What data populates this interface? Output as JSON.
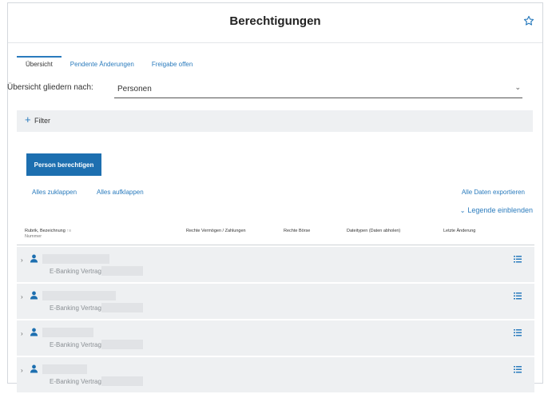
{
  "header": {
    "title": "Berechtigungen",
    "star_icon": "star-icon"
  },
  "tabs": [
    {
      "label": "Übersicht",
      "active": true
    },
    {
      "label": "Pendente Änderungen",
      "active": false
    },
    {
      "label": "Freigabe offen",
      "active": false
    }
  ],
  "grouping": {
    "label": "Übersicht gliedern nach:",
    "value": "Personen"
  },
  "filter": {
    "label": "Filter"
  },
  "actions": {
    "primary_label": "Person berechtigen",
    "collapse_all": "Alles zuklappen",
    "expand_all": "Alles aufklappen",
    "export_all": "Alle Daten exportieren",
    "legend_toggle": "Legende einblenden"
  },
  "table": {
    "columns": {
      "rubrik": "Rubrik, Bezeichnung",
      "rubrik_sub": "Nummer",
      "rechte_vermoegen": "Rechte Vermögen / Zahlungen",
      "rechte_boerse": "Rechte Börse",
      "dateitypen": "Dateitypen (Daten abholen)",
      "letzte_aenderung": "Letzte Änderung"
    },
    "rows": [
      {
        "subtitle": "E-Banking Vertrag"
      },
      {
        "subtitle": "E-Banking Vertrag"
      },
      {
        "subtitle": "E-Banking Vertrag"
      },
      {
        "subtitle": "E-Banking Vertrag"
      }
    ]
  },
  "colors": {
    "accent": "#1d6fb0",
    "link": "#2a7bbd",
    "row_bg": "#eef0f2"
  }
}
